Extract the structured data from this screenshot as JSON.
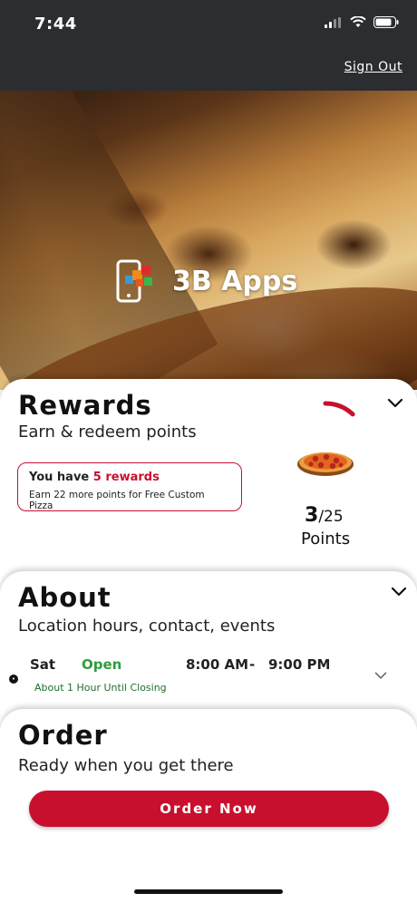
{
  "status": {
    "time": "7:44"
  },
  "header": {
    "sign_out": "Sign Out"
  },
  "brand": {
    "name": "3B Apps"
  },
  "rewards": {
    "title": "Rewards",
    "subtitle": "Earn & redeem points",
    "you_have": "You have",
    "rewards_count": "5 rewards",
    "earn_more": "Earn 22 more points for Free Custom Pizza",
    "points_current": "3",
    "points_total": "/25",
    "points_label": "Points",
    "progress_fraction": 0.12
  },
  "about": {
    "title": "About",
    "subtitle": "Location hours, contact, events",
    "day": "Sat",
    "status": "Open",
    "open_time": "8:00 AM",
    "separator": "-",
    "close_time": "9:00 PM",
    "until_closing": "About 1 Hour Until Closing"
  },
  "order": {
    "title": "Order",
    "subtitle": "Ready when you get there",
    "button": "Order Now"
  },
  "colors": {
    "accent": "#c8102e",
    "open_green": "#2e9d3e",
    "header_bg": "#2b2d30"
  }
}
